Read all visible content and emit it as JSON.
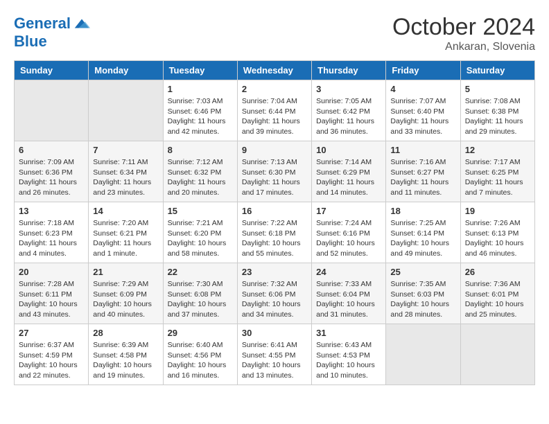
{
  "header": {
    "logo_line1": "General",
    "logo_line2": "Blue",
    "month": "October 2024",
    "location": "Ankaran, Slovenia"
  },
  "weekdays": [
    "Sunday",
    "Monday",
    "Tuesday",
    "Wednesday",
    "Thursday",
    "Friday",
    "Saturday"
  ],
  "weeks": [
    [
      {
        "day": "",
        "info": ""
      },
      {
        "day": "",
        "info": ""
      },
      {
        "day": "1",
        "info": "Sunrise: 7:03 AM\nSunset: 6:46 PM\nDaylight: 11 hours and 42 minutes."
      },
      {
        "day": "2",
        "info": "Sunrise: 7:04 AM\nSunset: 6:44 PM\nDaylight: 11 hours and 39 minutes."
      },
      {
        "day": "3",
        "info": "Sunrise: 7:05 AM\nSunset: 6:42 PM\nDaylight: 11 hours and 36 minutes."
      },
      {
        "day": "4",
        "info": "Sunrise: 7:07 AM\nSunset: 6:40 PM\nDaylight: 11 hours and 33 minutes."
      },
      {
        "day": "5",
        "info": "Sunrise: 7:08 AM\nSunset: 6:38 PM\nDaylight: 11 hours and 29 minutes."
      }
    ],
    [
      {
        "day": "6",
        "info": "Sunrise: 7:09 AM\nSunset: 6:36 PM\nDaylight: 11 hours and 26 minutes."
      },
      {
        "day": "7",
        "info": "Sunrise: 7:11 AM\nSunset: 6:34 PM\nDaylight: 11 hours and 23 minutes."
      },
      {
        "day": "8",
        "info": "Sunrise: 7:12 AM\nSunset: 6:32 PM\nDaylight: 11 hours and 20 minutes."
      },
      {
        "day": "9",
        "info": "Sunrise: 7:13 AM\nSunset: 6:30 PM\nDaylight: 11 hours and 17 minutes."
      },
      {
        "day": "10",
        "info": "Sunrise: 7:14 AM\nSunset: 6:29 PM\nDaylight: 11 hours and 14 minutes."
      },
      {
        "day": "11",
        "info": "Sunrise: 7:16 AM\nSunset: 6:27 PM\nDaylight: 11 hours and 11 minutes."
      },
      {
        "day": "12",
        "info": "Sunrise: 7:17 AM\nSunset: 6:25 PM\nDaylight: 11 hours and 7 minutes."
      }
    ],
    [
      {
        "day": "13",
        "info": "Sunrise: 7:18 AM\nSunset: 6:23 PM\nDaylight: 11 hours and 4 minutes."
      },
      {
        "day": "14",
        "info": "Sunrise: 7:20 AM\nSunset: 6:21 PM\nDaylight: 11 hours and 1 minute."
      },
      {
        "day": "15",
        "info": "Sunrise: 7:21 AM\nSunset: 6:20 PM\nDaylight: 10 hours and 58 minutes."
      },
      {
        "day": "16",
        "info": "Sunrise: 7:22 AM\nSunset: 6:18 PM\nDaylight: 10 hours and 55 minutes."
      },
      {
        "day": "17",
        "info": "Sunrise: 7:24 AM\nSunset: 6:16 PM\nDaylight: 10 hours and 52 minutes."
      },
      {
        "day": "18",
        "info": "Sunrise: 7:25 AM\nSunset: 6:14 PM\nDaylight: 10 hours and 49 minutes."
      },
      {
        "day": "19",
        "info": "Sunrise: 7:26 AM\nSunset: 6:13 PM\nDaylight: 10 hours and 46 minutes."
      }
    ],
    [
      {
        "day": "20",
        "info": "Sunrise: 7:28 AM\nSunset: 6:11 PM\nDaylight: 10 hours and 43 minutes."
      },
      {
        "day": "21",
        "info": "Sunrise: 7:29 AM\nSunset: 6:09 PM\nDaylight: 10 hours and 40 minutes."
      },
      {
        "day": "22",
        "info": "Sunrise: 7:30 AM\nSunset: 6:08 PM\nDaylight: 10 hours and 37 minutes."
      },
      {
        "day": "23",
        "info": "Sunrise: 7:32 AM\nSunset: 6:06 PM\nDaylight: 10 hours and 34 minutes."
      },
      {
        "day": "24",
        "info": "Sunrise: 7:33 AM\nSunset: 6:04 PM\nDaylight: 10 hours and 31 minutes."
      },
      {
        "day": "25",
        "info": "Sunrise: 7:35 AM\nSunset: 6:03 PM\nDaylight: 10 hours and 28 minutes."
      },
      {
        "day": "26",
        "info": "Sunrise: 7:36 AM\nSunset: 6:01 PM\nDaylight: 10 hours and 25 minutes."
      }
    ],
    [
      {
        "day": "27",
        "info": "Sunrise: 6:37 AM\nSunset: 4:59 PM\nDaylight: 10 hours and 22 minutes."
      },
      {
        "day": "28",
        "info": "Sunrise: 6:39 AM\nSunset: 4:58 PM\nDaylight: 10 hours and 19 minutes."
      },
      {
        "day": "29",
        "info": "Sunrise: 6:40 AM\nSunset: 4:56 PM\nDaylight: 10 hours and 16 minutes."
      },
      {
        "day": "30",
        "info": "Sunrise: 6:41 AM\nSunset: 4:55 PM\nDaylight: 10 hours and 13 minutes."
      },
      {
        "day": "31",
        "info": "Sunrise: 6:43 AM\nSunset: 4:53 PM\nDaylight: 10 hours and 10 minutes."
      },
      {
        "day": "",
        "info": ""
      },
      {
        "day": "",
        "info": ""
      }
    ]
  ]
}
